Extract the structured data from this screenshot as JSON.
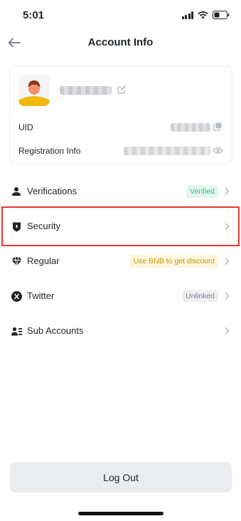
{
  "status_bar": {
    "time": "5:01"
  },
  "header": {
    "title": "Account Info"
  },
  "profile": {
    "uid_label": "UID",
    "registration_label": "Registration Info"
  },
  "menu": [
    {
      "label": "Verifications",
      "icon": "person-icon",
      "badge": "Verified",
      "badge_color": "#2ebd85"
    },
    {
      "label": "Security",
      "icon": "shield-icon"
    },
    {
      "label": "Regular",
      "icon": "diamond-icon",
      "badge": "Use BNB to get discount",
      "badge_color": "#c99400"
    },
    {
      "label": "Twitter",
      "icon": "x-logo-icon",
      "badge": "Unlinked",
      "badge_color": "#707a8a"
    },
    {
      "label": "Sub Accounts",
      "icon": "sub-accounts-icon"
    }
  ],
  "logout": {
    "label": "Log Out"
  },
  "colors": {
    "highlight": "#e53935",
    "text": "#1e2329",
    "avatar_accent": "#f0b90b"
  }
}
